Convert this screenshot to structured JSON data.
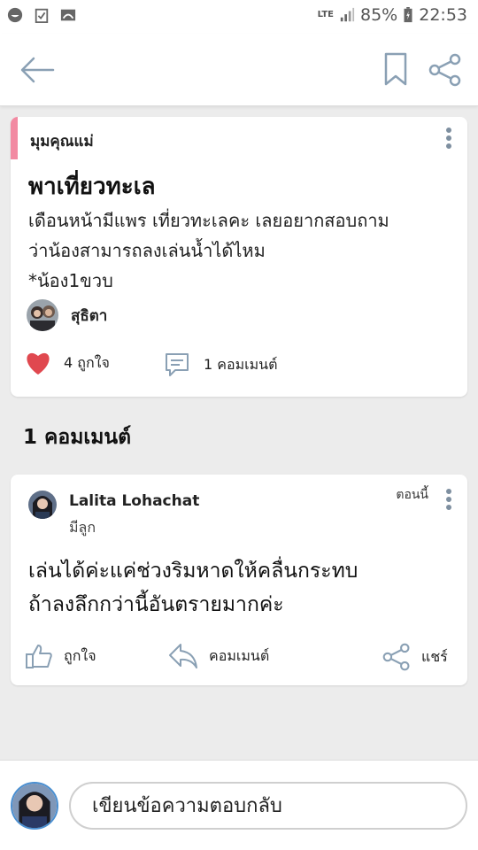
{
  "status_bar": {
    "network": "LTE",
    "battery": "85%",
    "time": "22:53",
    "icons": [
      "app-notification-icon",
      "clipboard-check-icon",
      "image-icon",
      "signal-icon",
      "battery-icon"
    ]
  },
  "appbar": {
    "icons": [
      "back-arrow-icon",
      "bookmark-icon",
      "share-icon"
    ]
  },
  "post": {
    "category": "มุมคุณแม่",
    "title": "พาเที่ยวทะเล",
    "body_line1": "เดือนหน้ามีแพร เที่ยวทะเลคะ เลยอยากสอบถาม",
    "body_line2": "ว่าน้องสามารถลงเล่นน้ำได้ไหม",
    "body_line3": "*น้อง1ขวบ",
    "author": "สุธิตา",
    "likes": "4 ถูกใจ",
    "comments": "1 คอมเมนต์"
  },
  "comments_heading": "1 คอมเมนต์",
  "comment": {
    "name": "Lalita Lohachat",
    "role": "มีลูก",
    "time": "ตอนนี้",
    "text_line1": "เล่นได้ค่ะแค่ช่วงริมหาดให้คลื่นกระทบ",
    "text_line2": "ถ้าลงลึกกว่านี้อันตรายมากค่ะ",
    "like_label": "ถูกใจ",
    "comment_label": "คอมเมนต์",
    "share_label": "แชร์"
  },
  "reply": {
    "placeholder": "เขียนข้อความตอบกลับ"
  },
  "colors": {
    "accent_pink": "#f28aa2",
    "heart_red": "#e0484f",
    "icon_gray": "#8aa0b4"
  }
}
